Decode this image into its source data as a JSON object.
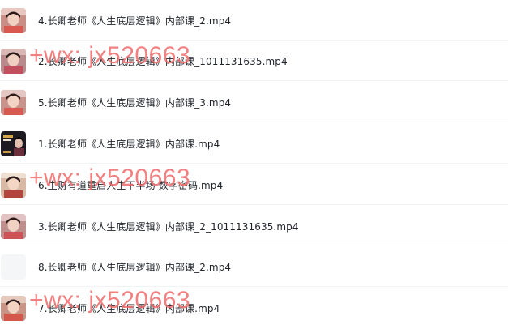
{
  "files": [
    {
      "name": "4.长卿老师《人生底层逻辑》内部课_2.mp4",
      "thumbnail": "person-video-thumbnail"
    },
    {
      "name": "2.长卿老师《人生底层逻辑》内部课_1011131635.mp4",
      "thumbnail": "person-video-thumbnail"
    },
    {
      "name": "5.长卿老师《人生底层逻辑》内部课_3.mp4",
      "thumbnail": "person-video-thumbnail"
    },
    {
      "name": "1.长卿老师《人生底层逻辑》内部课.mp4",
      "thumbnail": "dark-stage-thumbnail"
    },
    {
      "name": "6.生财有道重启人生下半场 数字密码.mp4",
      "thumbnail": "person-video-thumbnail"
    },
    {
      "name": "3.长卿老师《人生底层逻辑》内部课_2_1011131635.mp4",
      "thumbnail": "person-video-thumbnail"
    },
    {
      "name": "8.长卿老师《人生底层逻辑》内部课_2.mp4",
      "thumbnail": "blank-thumbnail"
    },
    {
      "name": "7.长卿老师《人生底层逻辑》内部课.mp4",
      "thumbnail": "person-video-thumbnail"
    }
  ],
  "watermarks": [
    {
      "text": "+wx: jx520663"
    },
    {
      "text": "+wx: jx520663"
    },
    {
      "text": "+wx: jx520663"
    }
  ],
  "colors": {
    "watermark": "#f26b6b",
    "text": "#1f2329",
    "divider": "#f2f3f5"
  }
}
